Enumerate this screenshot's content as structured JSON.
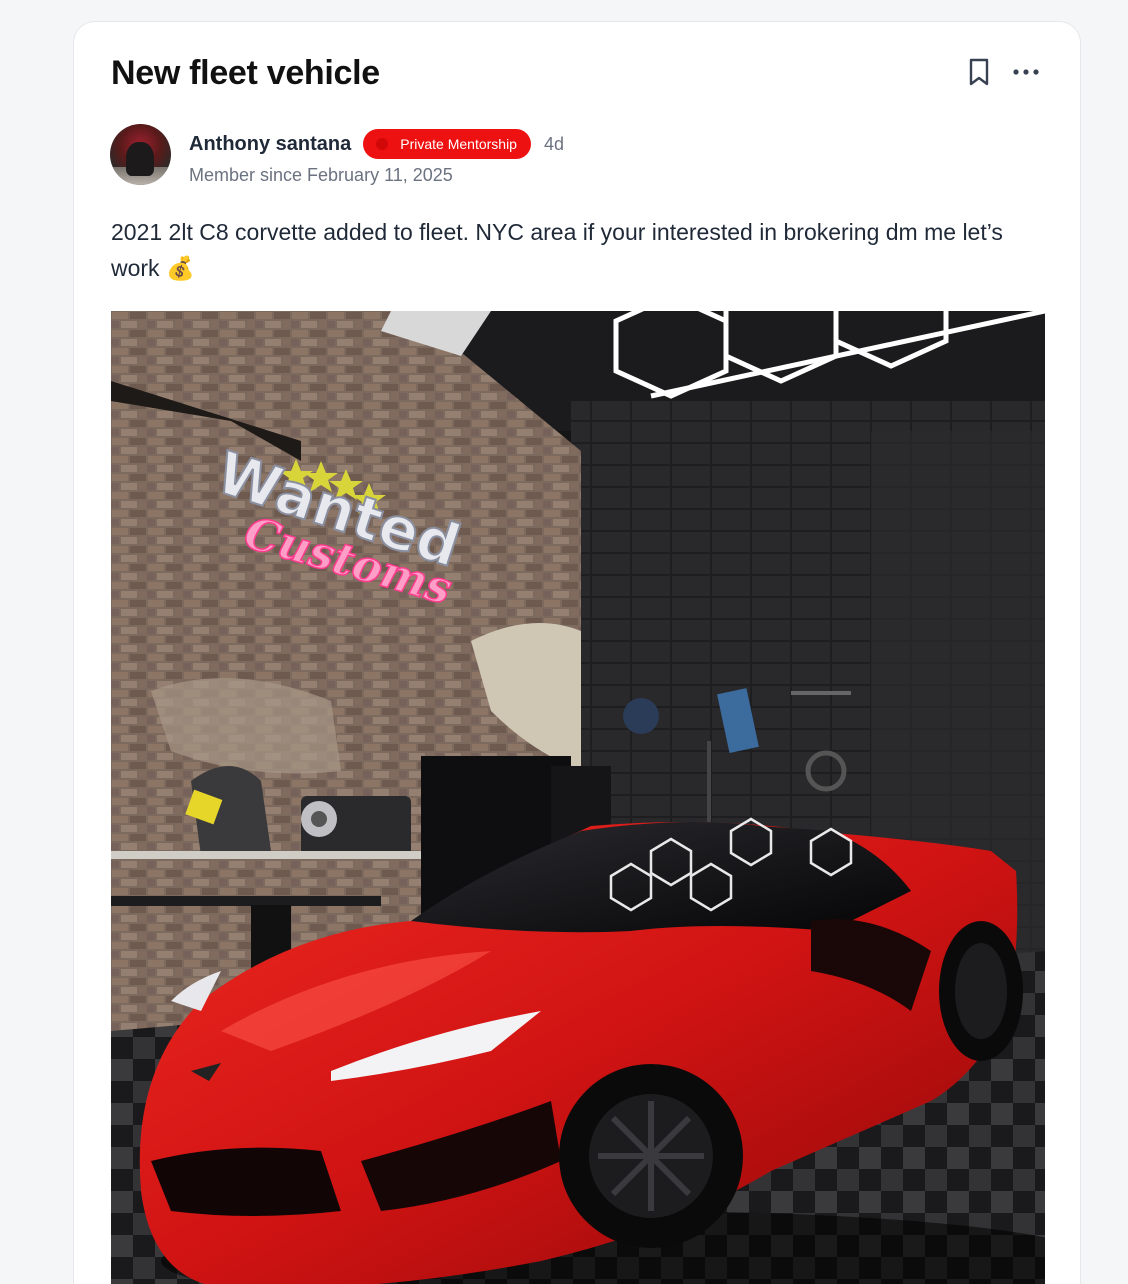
{
  "post": {
    "title": "New fleet vehicle",
    "body": "2021 2lt C8 corvette added to fleet. NYC area if your interested in brokering dm me let’s work 💰"
  },
  "author": {
    "name": "Anthony santana",
    "badge": "Private Mentorship",
    "time_ago": "4d",
    "member_since": "Member since February 11, 2025"
  },
  "image": {
    "wall_sign_line1": "Wanted",
    "wall_sign_line2": "Customs"
  },
  "icons": {
    "bookmark": "bookmark-icon",
    "more": "more-horizontal-icon"
  },
  "colors": {
    "badge": "#ee1111",
    "car": "#d81515"
  }
}
